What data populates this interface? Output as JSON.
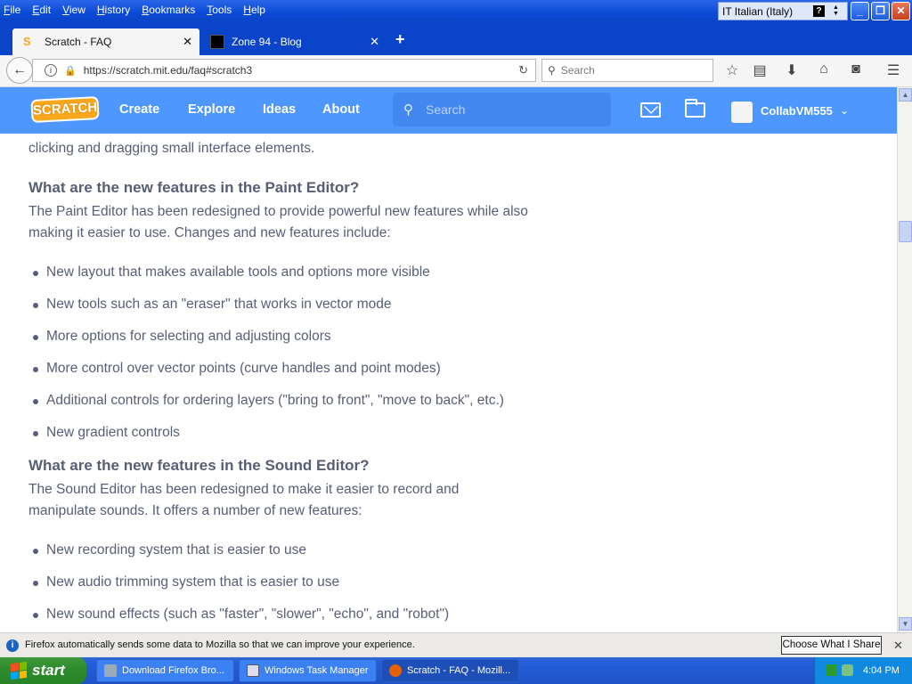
{
  "menubar": {
    "items": [
      "File",
      "Edit",
      "View",
      "History",
      "Bookmarks",
      "Tools",
      "Help"
    ],
    "language": "IT Italian (Italy)",
    "help_glyph": "?"
  },
  "tabs": [
    {
      "title": "Scratch - FAQ",
      "active": true
    },
    {
      "title": "Zone 94 - Blog",
      "active": false
    }
  ],
  "nav": {
    "url": "https://scratch.mit.edu/faq#scratch3",
    "search_placeholder": "Search"
  },
  "scratch_header": {
    "logo": "SCRATCH",
    "nav": [
      "Create",
      "Explore",
      "Ideas",
      "About"
    ],
    "search_placeholder": "Search",
    "username": "CollabVM555"
  },
  "content": {
    "intro_tail": "clicking and dragging small interface elements.",
    "paint_heading": "What are the new features in the Paint Editor?",
    "paint_para": "The Paint Editor has been redesigned to provide powerful new features while also making it easier to use. Changes and new features include:",
    "paint_items": [
      "New layout that makes available tools and options more visible",
      "New tools such as an \"eraser\" that works in vector mode",
      "More options for selecting and adjusting colors",
      "More control over vector points (curve handles and point modes)",
      "Additional controls for ordering layers (\"bring to front\", \"move to back\", etc.)",
      "New gradient controls"
    ],
    "sound_heading": "What are the new features in the Sound Editor?",
    "sound_para": "The Sound Editor has been redesigned to make it easier to record and manipulate sounds. It offers a number of new features:",
    "sound_items": [
      "New recording system that is easier to use",
      "New audio trimming system that is easier to use",
      "New sound effects (such as \"faster\", \"slower\", \"echo\", and \"robot\")"
    ]
  },
  "notification": {
    "message": "Firefox automatically sends some data to Mozilla so that we can improve your experience.",
    "button": "Choose What I Share"
  },
  "taskbar": {
    "start": "start",
    "tasks": [
      "Download Firefox Bro...",
      "Windows Task Manager",
      "Scratch - FAQ - Mozill..."
    ],
    "clock": "4:04 PM"
  },
  "colors": {
    "scratch_blue": "#4d97ff",
    "text": "#575e75",
    "xp_blue": "#0a45c9"
  }
}
